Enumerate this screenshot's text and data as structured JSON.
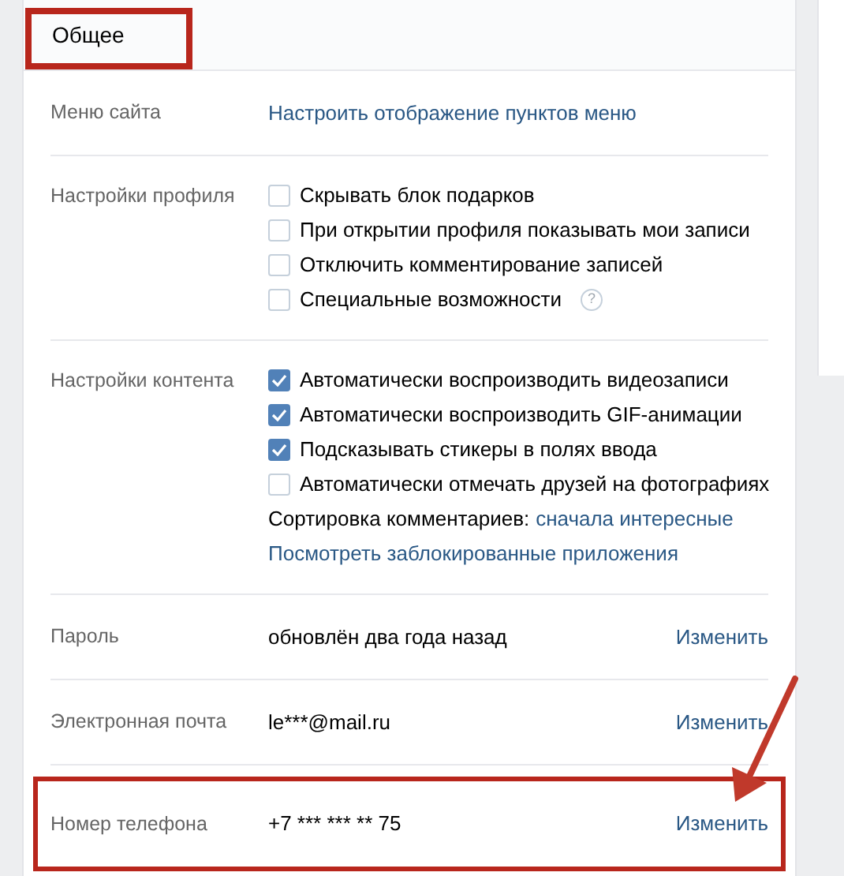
{
  "header": {
    "title": "Общее"
  },
  "sections": [
    {
      "label": "Меню сайта",
      "items": [
        {
          "kind": "link",
          "text": "Настроить отображение пунктов меню"
        }
      ]
    },
    {
      "label": "Настройки профиля",
      "items": [
        {
          "kind": "checkbox",
          "text": "Скрывать блок подарков",
          "checked": false
        },
        {
          "kind": "checkbox",
          "text": "При открытии профиля показывать мои записи",
          "checked": false
        },
        {
          "kind": "checkbox",
          "text": "Отключить комментирование записей",
          "checked": false
        },
        {
          "kind": "checkbox",
          "text": "Специальные возможности",
          "checked": false,
          "help": "?"
        }
      ]
    },
    {
      "label": "Настройки контента",
      "items": [
        {
          "kind": "checkbox",
          "text": "Автоматически воспроизводить видеозаписи",
          "checked": true
        },
        {
          "kind": "checkbox",
          "text": "Автоматически воспроизводить GIF-анимации",
          "checked": true
        },
        {
          "kind": "checkbox",
          "text": "Подсказывать стикеры в полях ввода",
          "checked": true
        },
        {
          "kind": "checkbox",
          "text": "Автоматически отмечать друзей на фотографиях",
          "checked": false
        },
        {
          "kind": "sort",
          "text": "Сортировка комментариев:",
          "value": "сначала интересные"
        },
        {
          "kind": "link",
          "text": "Посмотреть заблокированные приложения"
        }
      ]
    },
    {
      "label": "Пароль",
      "items": [
        {
          "kind": "value",
          "text": "обновлён два года назад",
          "action": "Изменить"
        }
      ]
    },
    {
      "label": "Электронная почта",
      "items": [
        {
          "kind": "value",
          "text": "le***@mail.ru",
          "action": "Изменить"
        }
      ]
    },
    {
      "label": "Номер телефона",
      "highlighted": true,
      "items": [
        {
          "kind": "value",
          "text": "+7 *** *** ** 75",
          "action": "Изменить"
        }
      ]
    }
  ]
}
